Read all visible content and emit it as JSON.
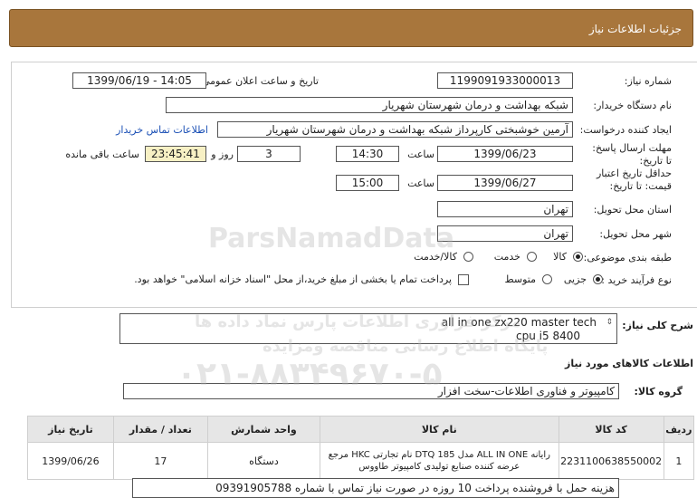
{
  "header": {
    "title": "جزئیات اطلاعات نیاز"
  },
  "form": {
    "need_number_label": "شماره نیاز:",
    "need_number": "1199091933000013",
    "announce_label": "تاریخ و ساعت اعلان عمومی:",
    "announce_value": "1399/06/19 - 14:05",
    "buyer_label": "نام دستگاه خریدار:",
    "buyer_value": "شبکه بهداشت و درمان شهرستان شهریار",
    "creator_label": "ایجاد کننده درخواست:",
    "creator_value": "آرمین خوشبختی کارپرداز شبکه بهداشت و درمان شهرستان شهریار",
    "contact_link": "اطلاعات تماس خریدار",
    "deadline_label": "مهلت ارسال پاسخ: تا تاریخ:",
    "deadline_date": "1399/06/23",
    "time_label": "ساعت",
    "deadline_time": "14:30",
    "days_value": "3",
    "days_label": "روز و",
    "remaining_time": "23:45:41",
    "remaining_label": "ساعت باقی مانده",
    "validity_label": "حداقل تاریخ اعتبار قیمت: تا تاریخ:",
    "validity_date": "1399/06/27",
    "validity_time": "15:00",
    "province_label": "استان محل تحویل:",
    "province_value": "تهران",
    "city_label": "شهر محل تحویل:",
    "city_value": "تهران",
    "category_label": "طبقه بندی موضوعی:",
    "category_options": [
      "کالا",
      "خدمت",
      "کالا/خدمت"
    ],
    "category_selected": "کالا",
    "process_label": "نوع فرآیند خرید :",
    "process_options": [
      "جزیی",
      "متوسط"
    ],
    "process_selected": "جزیی",
    "payment_note": "پرداخت تمام یا بخشی از مبلغ خرید،از محل \"اسناد خزانه اسلامی\" خواهد بود."
  },
  "description": {
    "label": "شرح کلی نیاز:",
    "line1": "all in one zx220 master tech",
    "line2": "cpu i5 8400"
  },
  "goods_section": {
    "title": "اطلاعات کالاهای مورد نیاز",
    "group_label": "گروه کالا:",
    "group_value": "کامپیوتر و فناوری اطلاعات-سخت افزار"
  },
  "table": {
    "headers": [
      "ردیف",
      "کد کالا",
      "نام کالا",
      "واحد شمارش",
      "تعداد / مقدار",
      "تاریخ نیاز"
    ],
    "rows": [
      {
        "index": "1",
        "code": "2231100638550002",
        "name": "رایانه ALL IN ONE مدل DTQ 185 نام تجارتی HKC مرجع عرضه کننده صنایع تولیدی کامپیوتر طاووس",
        "unit": "دستگاه",
        "qty": "17",
        "date": "1399/06/26"
      }
    ]
  },
  "footer_note": "هزینه حمل با فروشنده پرداخت 10 روزه در صورت نیاز تماس با شماره 09391905788",
  "watermark": {
    "brand": "ParsNamadData",
    "line1": "مرکز فراوری اطلاعات پارس نماد داده ها",
    "line2": "پایگاه اطلاع رسانی مناقصه ومزایده",
    "phone": "۰۲۱-۸۸۳۴۹۶۷۰-۵"
  }
}
